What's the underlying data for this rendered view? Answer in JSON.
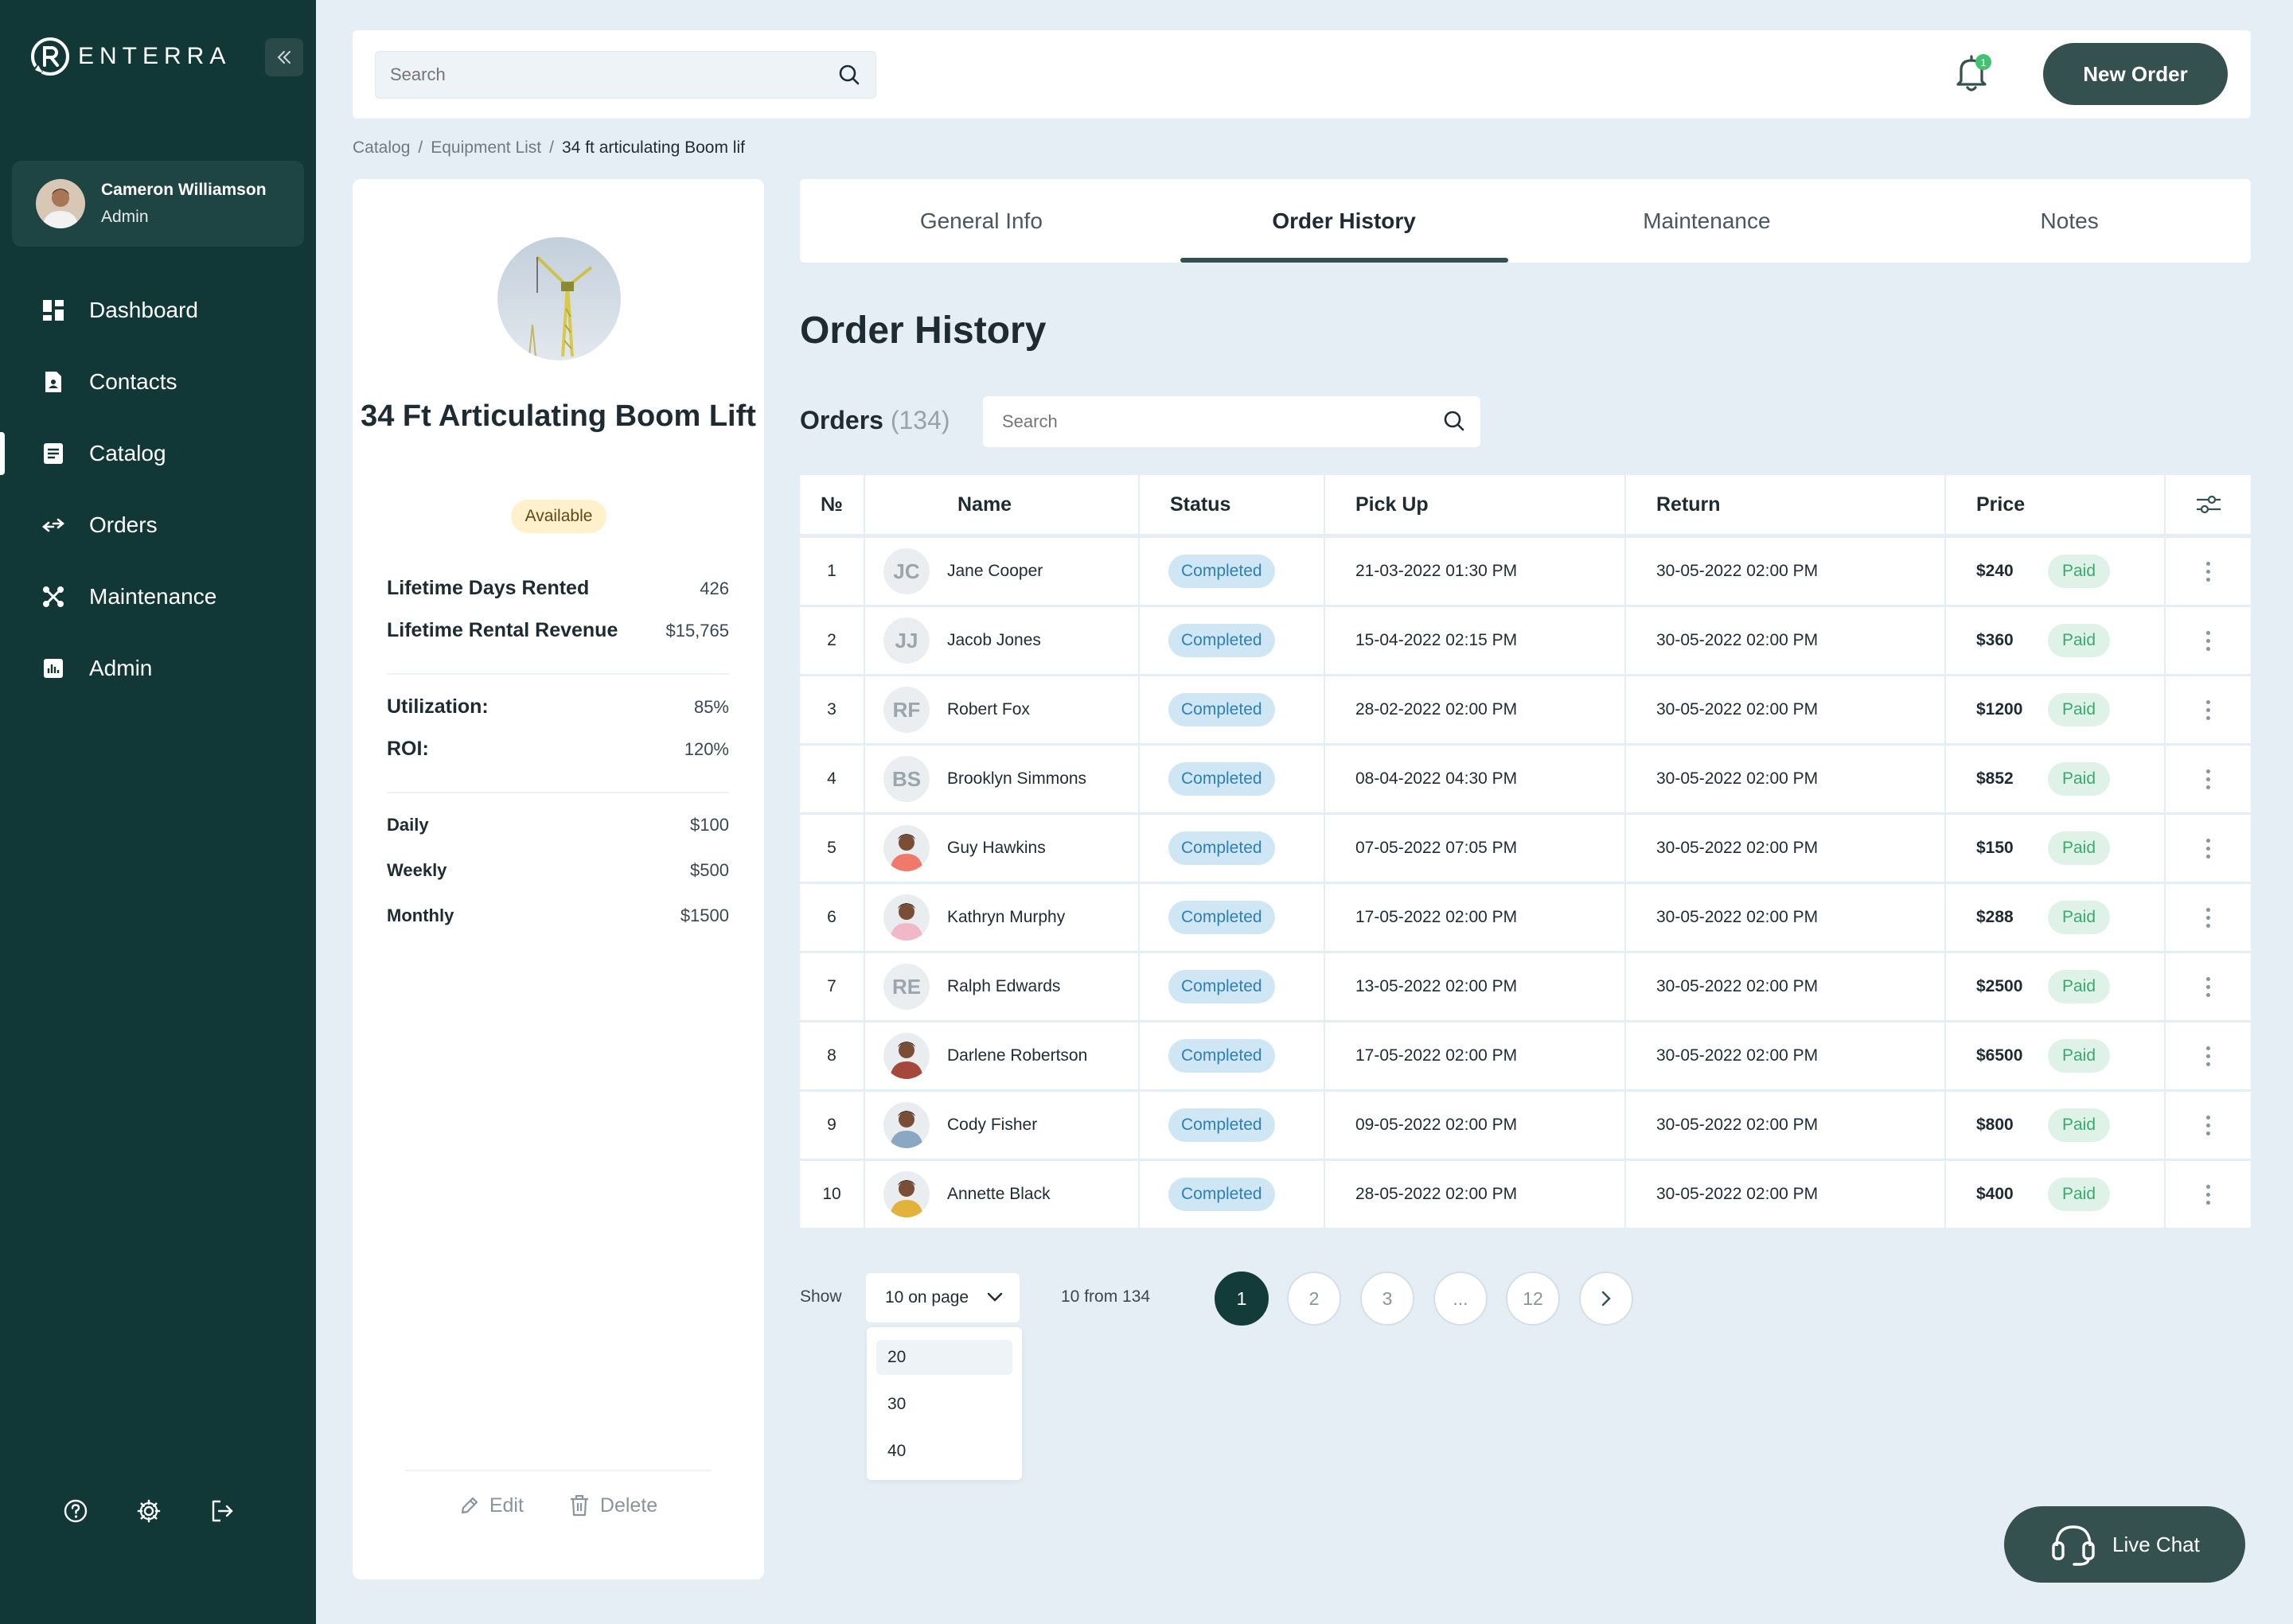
{
  "app": {
    "logo_text": "ENTERRA",
    "user": {
      "name": "Cameron Williamson",
      "role": "Admin"
    },
    "nav": [
      {
        "label": "Dashboard",
        "icon": "dashboard-icon"
      },
      {
        "label": "Contacts",
        "icon": "contacts-icon"
      },
      {
        "label": "Catalog",
        "icon": "catalog-icon",
        "active": true
      },
      {
        "label": "Orders",
        "icon": "orders-icon"
      },
      {
        "label": "Maintenance",
        "icon": "maintenance-icon"
      },
      {
        "label": "Admin",
        "icon": "admin-icon"
      }
    ],
    "bottom_icons": [
      "help-icon",
      "settings-icon",
      "logout-icon"
    ]
  },
  "topbar": {
    "search_placeholder": "Search",
    "notification_count": "1",
    "new_order_label": "New Order"
  },
  "breadcrumb": [
    "Catalog",
    "Equipment List",
    "34 ft articulating Boom lif"
  ],
  "equipment": {
    "title": "34 Ft Articulating Boom Lift",
    "status": "Available",
    "stats1": [
      {
        "k": "Lifetime Days Rented",
        "v": "426"
      },
      {
        "k": "Lifetime Rental Revenue",
        "v": "$15,765"
      }
    ],
    "stats2": [
      {
        "k": "Utilization:",
        "v": "85%"
      },
      {
        "k": "ROI:",
        "v": "120%"
      }
    ],
    "rates": [
      {
        "k": "Daily",
        "v": "$100"
      },
      {
        "k": "Weekly",
        "v": "$500"
      },
      {
        "k": "Monthly",
        "v": "$1500"
      }
    ],
    "edit_label": "Edit",
    "delete_label": "Delete"
  },
  "tabs": [
    {
      "label": "General Info"
    },
    {
      "label": "Order History",
      "active": true
    },
    {
      "label": "Maintenance"
    },
    {
      "label": "Notes"
    }
  ],
  "orders": {
    "section_title": "Order History",
    "label": "Orders",
    "count": "(134)",
    "search_placeholder": "Search",
    "columns": [
      "№",
      "Name",
      "Status",
      "Pick Up",
      "Return",
      "Price"
    ],
    "rows": [
      {
        "no": "1",
        "name": "Jane Cooper",
        "initials": "JC",
        "status": "Completed",
        "pickup": "21-03-2022 01:30 PM",
        "return": "30-05-2022 02:00 PM",
        "price": "$240",
        "payment": "Paid"
      },
      {
        "no": "2",
        "name": "Jacob Jones",
        "initials": "JJ",
        "status": "Completed",
        "pickup": "15-04-2022 02:15 PM",
        "return": "30-05-2022 02:00 PM",
        "price": "$360",
        "payment": "Paid"
      },
      {
        "no": "3",
        "name": "Robert Fox",
        "initials": "RF",
        "status": "Completed",
        "pickup": "28-02-2022 02:00 PM",
        "return": "30-05-2022 02:00 PM",
        "price": "$1200",
        "payment": "Paid"
      },
      {
        "no": "4",
        "name": "Brooklyn Simmons",
        "initials": "BS",
        "status": "Completed",
        "pickup": "08-04-2022 04:30 PM",
        "return": "30-05-2022 02:00 PM",
        "price": "$852",
        "payment": "Paid"
      },
      {
        "no": "5",
        "name": "Guy Hawkins",
        "photo": "#f07a6a",
        "status": "Completed",
        "pickup": "07-05-2022 07:05 PM",
        "return": "30-05-2022 02:00 PM",
        "price": "$150",
        "payment": "Paid"
      },
      {
        "no": "6",
        "name": "Kathryn Murphy",
        "photo": "#f3b8c8",
        "status": "Completed",
        "pickup": "17-05-2022 02:00 PM",
        "return": "30-05-2022 02:00 PM",
        "price": "$288",
        "payment": "Paid"
      },
      {
        "no": "7",
        "name": "Ralph Edwards",
        "initials": "RE",
        "status": "Completed",
        "pickup": "13-05-2022 02:00 PM",
        "return": "30-05-2022 02:00 PM",
        "price": "$2500",
        "payment": "Paid"
      },
      {
        "no": "8",
        "name": "Darlene Robertson",
        "photo": "#a5473b",
        "status": "Completed",
        "pickup": "17-05-2022 02:00 PM",
        "return": "30-05-2022 02:00 PM",
        "price": "$6500",
        "payment": "Paid"
      },
      {
        "no": "9",
        "name": "Cody Fisher",
        "photo": "#8aa7c4",
        "status": "Completed",
        "pickup": "09-05-2022 02:00 PM",
        "return": "30-05-2022 02:00 PM",
        "price": "$800",
        "payment": "Paid"
      },
      {
        "no": "10",
        "name": "Annette Black",
        "photo": "#e3b23c",
        "status": "Completed",
        "pickup": "28-05-2022 02:00 PM",
        "return": "30-05-2022 02:00 PM",
        "price": "$400",
        "payment": "Paid"
      }
    ]
  },
  "pagination": {
    "show_label": "Show",
    "per_page": "10 on page",
    "range": "10 from 134",
    "pages": [
      "1",
      "2",
      "3",
      "...",
      "12"
    ],
    "current": "1",
    "options": [
      "20",
      "30",
      "40"
    ]
  },
  "live_chat_label": "Live Chat",
  "colors": {
    "sidebar": "#113837",
    "primary": "#34514f",
    "status_completed": "#cfe6f5",
    "paid": "#dff2e7",
    "available": "#fff1cc"
  }
}
